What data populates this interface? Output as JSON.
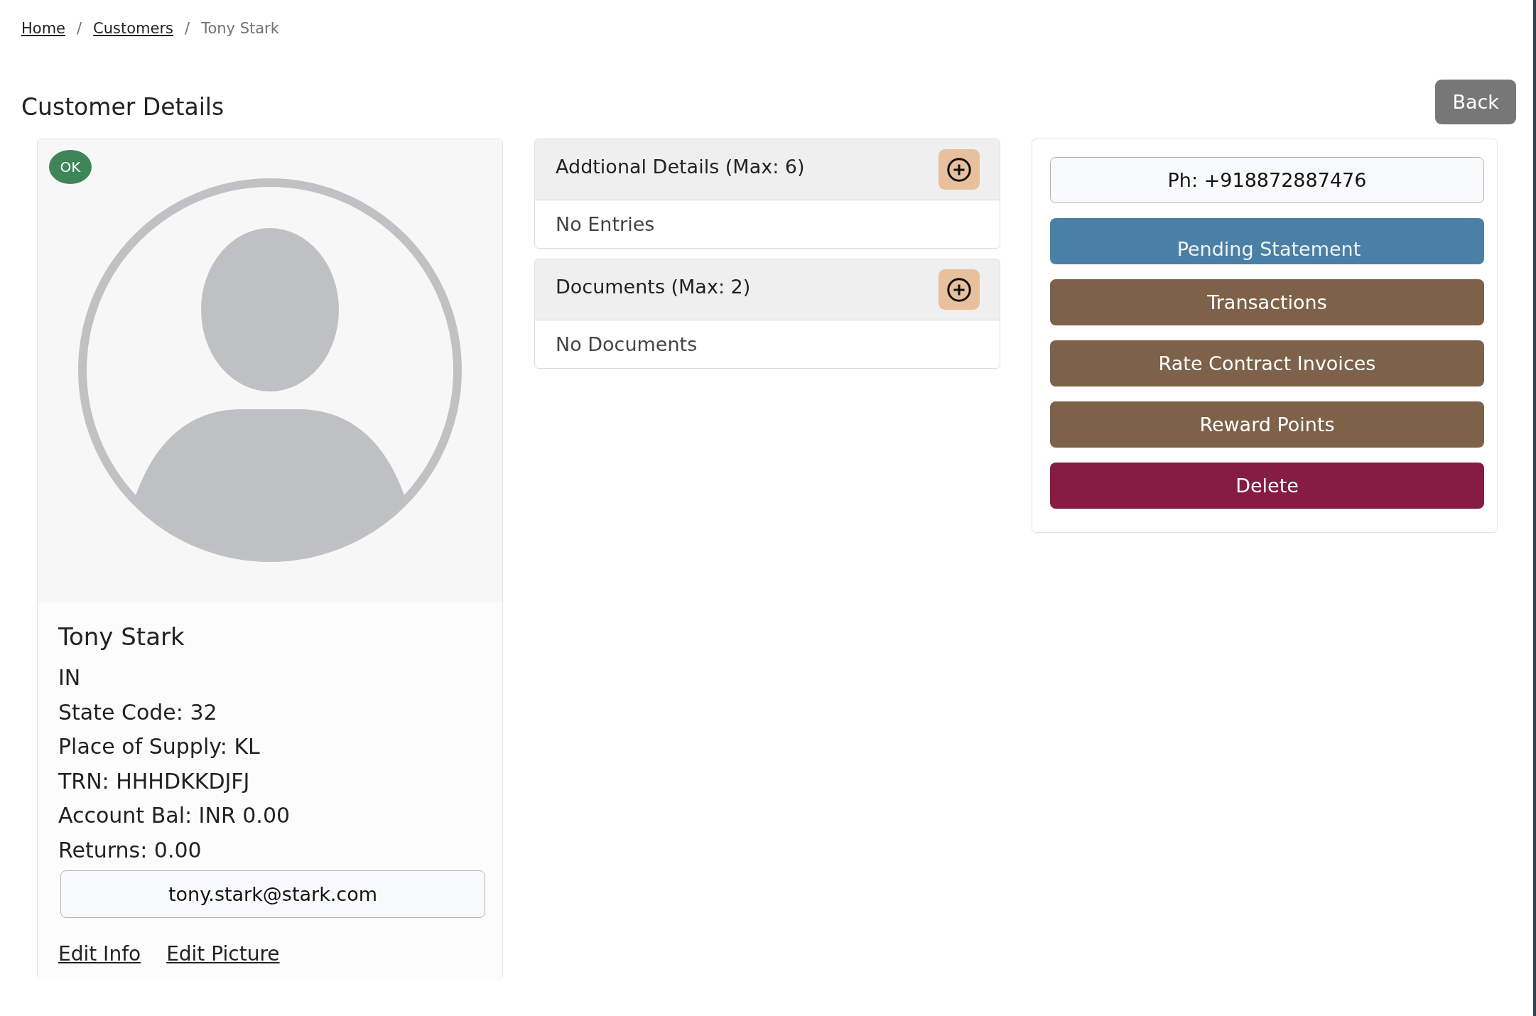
{
  "breadcrumb": [
    {
      "label": "Home",
      "kind": "link"
    },
    {
      "label": "Customers",
      "kind": "link"
    },
    {
      "label": "Tony Stark",
      "kind": "current"
    }
  ],
  "breadcrumb_separator": "/",
  "page_title": "Customer Details",
  "back_button": "Back",
  "profile": {
    "status_badge": "OK",
    "name": "Tony Stark",
    "details": [
      "IN",
      "State Code: 32",
      "Place of Supply: KL",
      "TRN: HHHDKKDJFJ",
      "Account Bal: INR 0.00",
      "Returns: 0.00"
    ],
    "email": "tony.stark@stark.com",
    "links": [
      "Edit Info",
      "Edit Picture"
    ]
  },
  "sections": [
    {
      "title": "Addtional Details (Max: 6)",
      "empty_text": "No Entries"
    },
    {
      "title": "Documents (Max: 2)",
      "empty_text": "No Documents"
    }
  ],
  "actions": [
    {
      "label": "Ph: +918872887476",
      "kind": "outline"
    },
    {
      "label": "Pending Statement",
      "kind": "info"
    },
    {
      "label": "Transactions",
      "kind": "brown"
    },
    {
      "label": "Rate Contract Invoices",
      "kind": "brown"
    },
    {
      "label": "Reward Points",
      "kind": "brown"
    },
    {
      "label": "Delete",
      "kind": "danger"
    }
  ]
}
